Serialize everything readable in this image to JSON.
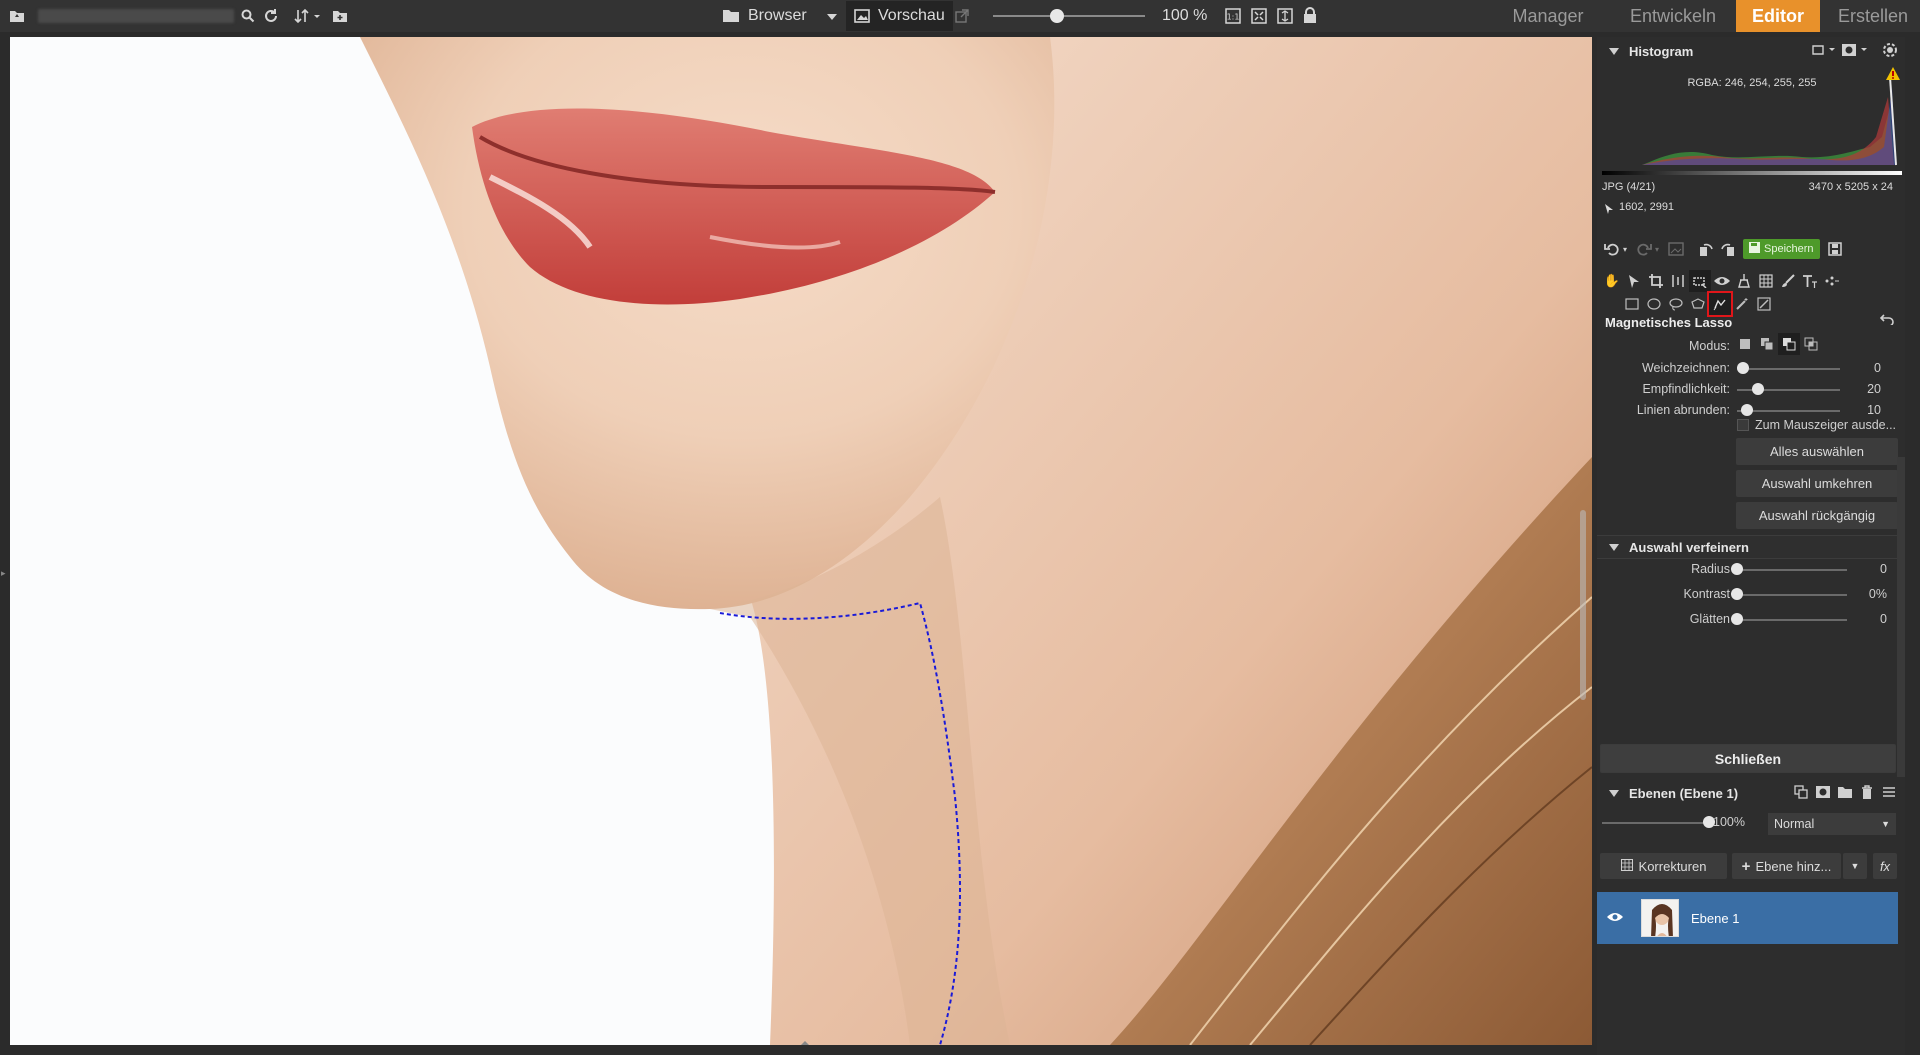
{
  "topbar": {
    "browser_label": "Browser",
    "preview_label": "Vorschau",
    "zoom_value": "100 %",
    "zoom_fraction": 0.42,
    "modes": [
      "Manager",
      "Entwickeln",
      "Editor",
      "Erstellen"
    ],
    "active_mode": "Editor",
    "accent": "#e8912b"
  },
  "histogram": {
    "title": "Histogram",
    "rgba": "RGBA: 246, 254, 255, 255",
    "file_info": "JPG  (4/21)",
    "dimensions": "3470 x 5205 x 24",
    "coords": "1602, 2991"
  },
  "actions": {
    "save_label": "Speichern",
    "save_color": "#4e9a2a"
  },
  "tool": {
    "title": "Magnetisches Lasso",
    "modus_label": "Modus:",
    "params": [
      {
        "label": "Weichzeichnen:",
        "value": "0",
        "fraction": 0.0
      },
      {
        "label": "Empfindlichkeit:",
        "value": "20",
        "fraction": 0.2
      },
      {
        "label": "Linien abrunden:",
        "value": "10",
        "fraction": 0.1
      }
    ],
    "checkbox_label": "Zum Mauszeiger ausde...",
    "checkbox_checked": false,
    "buttons": [
      "Alles auswählen",
      "Auswahl umkehren",
      "Auswahl rückgängig"
    ]
  },
  "refine": {
    "title": "Auswahl verfeinern",
    "params": [
      {
        "label": "Radius",
        "value": "0",
        "fraction": 0.0
      },
      {
        "label": "Kontrast",
        "value": "0%",
        "fraction": 0.0
      },
      {
        "label": "Glätten",
        "value": "0",
        "fraction": 0.0
      }
    ],
    "close_label": "Schließen"
  },
  "layers": {
    "title": "Ebenen (Ebene 1)",
    "opacity": "100%",
    "opacity_fraction": 1.0,
    "blend_mode": "Normal",
    "korrekturen_label": "Korrekturen",
    "add_layer_label": "Ebene hinz...",
    "fx_label": "fx",
    "items": [
      {
        "name": "Ebene 1",
        "visible": true,
        "selected": true
      }
    ],
    "selected_color": "#3a6ea5"
  }
}
